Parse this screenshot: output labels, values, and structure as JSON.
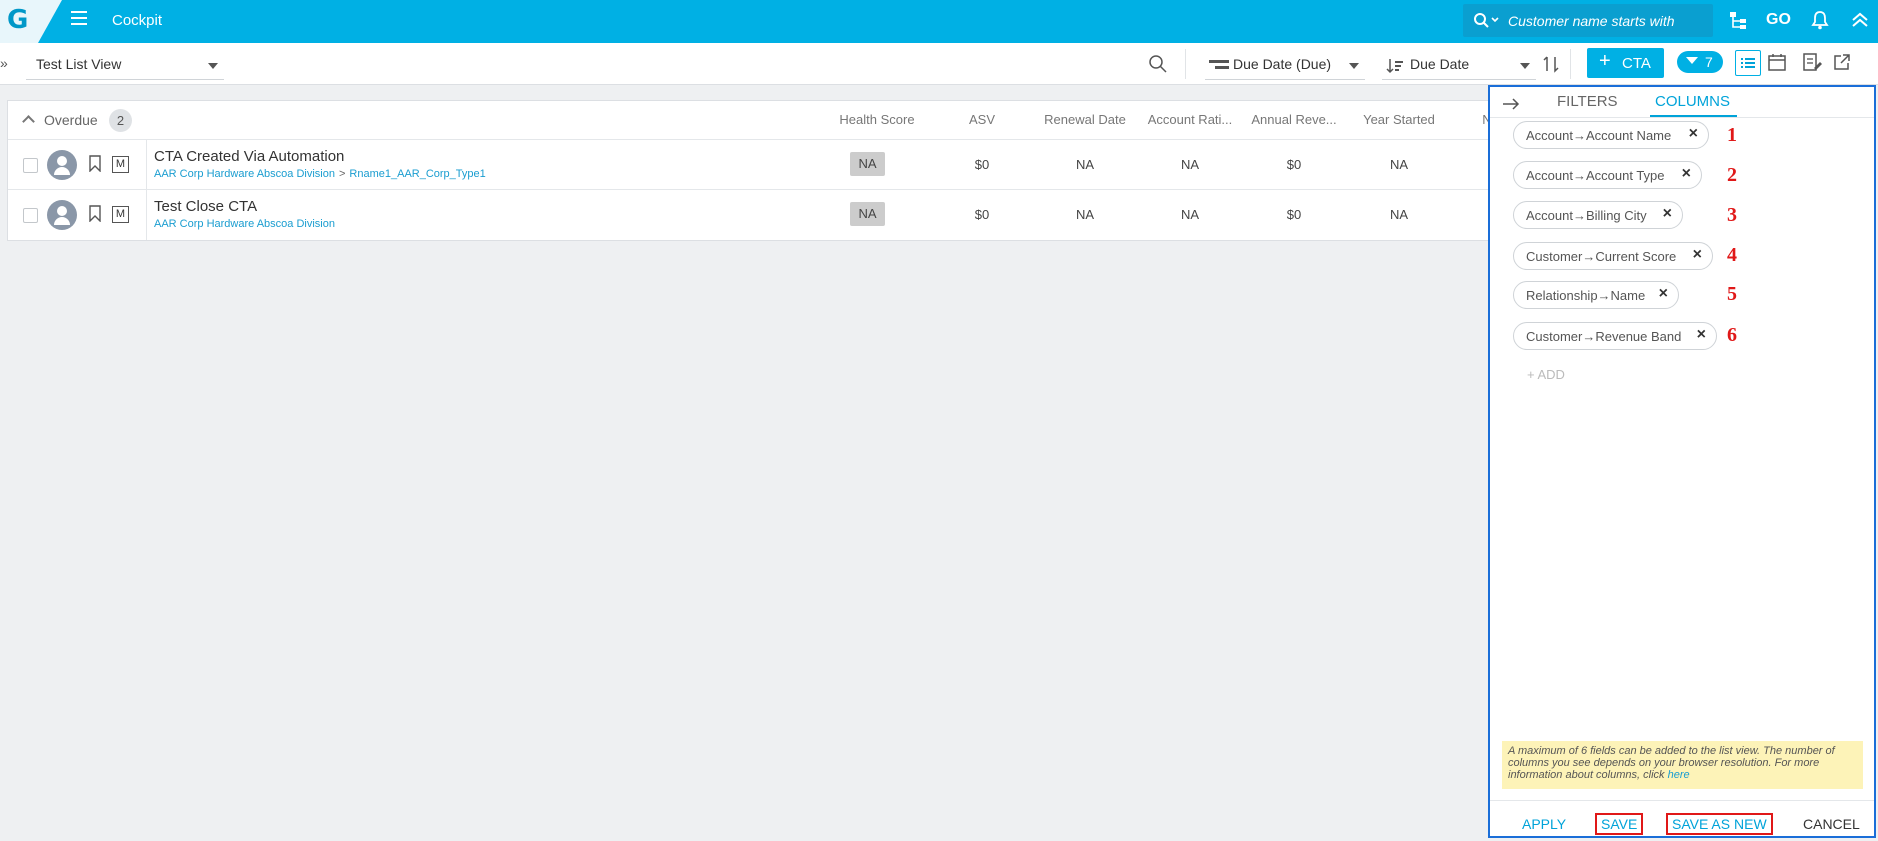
{
  "header": {
    "logo_letter": "G",
    "title": "Cockpit",
    "search_placeholder": "Customer name starts with",
    "go_label": "GO"
  },
  "toolbar": {
    "view_name": "Test List View",
    "sort_primary": "Due Date (Due)",
    "sort_secondary": "Due Date",
    "cta_label": "CTA",
    "filter_count": "7"
  },
  "group": {
    "name": "Overdue",
    "count": "2"
  },
  "columns": [
    "Health Score",
    "ASV",
    "Renewal Date",
    "Account Rati...",
    "Annual Reve...",
    "Year Started",
    "N"
  ],
  "rows": [
    {
      "title": "CTA Created Via Automation",
      "account": "AAR Corp Hardware Abscoa Division",
      "separator": ">",
      "relationship": "Rname1_AAR_Corp_Type1",
      "health": "NA",
      "asv": "$0",
      "renewal": "NA",
      "rating": "NA",
      "revenue": "$0",
      "year": "NA",
      "badge": "M"
    },
    {
      "title": "Test Close CTA",
      "account": "AAR Corp Hardware Abscoa Division",
      "separator": "",
      "relationship": "",
      "health": "NA",
      "asv": "$0",
      "renewal": "NA",
      "rating": "NA",
      "revenue": "$0",
      "year": "NA",
      "badge": "M"
    }
  ],
  "panel": {
    "tabs": [
      "FILTERS",
      "COLUMNS"
    ],
    "active_tab": "COLUMNS",
    "chips": [
      "Account→Account Name",
      "Account→Account Type",
      "Account→Billing City",
      "Customer→Current Score",
      "Relationship→Name",
      "Customer→Revenue Band"
    ],
    "markers": [
      "1",
      "2",
      "3",
      "4",
      "5",
      "6"
    ],
    "add_label": "+ ADD",
    "note_text": "A maximum of 6 fields can be added to the list view. The number of columns you see depends on your browser resolution. For more information about columns, click",
    "note_link": "here",
    "apply": "APPLY",
    "save": "SAVE",
    "save_as_new": "SAVE AS NEW",
    "cancel": "CANCEL"
  },
  "colors": {
    "brand": "#00b0e4",
    "panel_border": "#1a6ed8",
    "annotation_red": "#e01818"
  }
}
